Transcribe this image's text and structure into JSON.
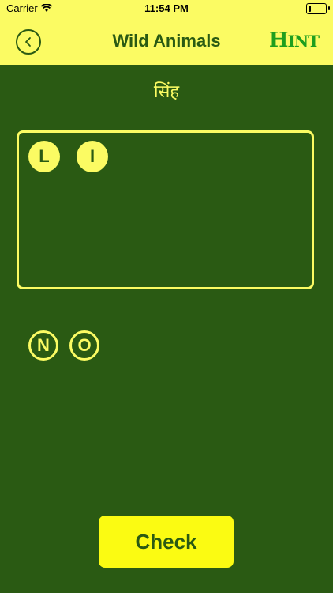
{
  "status_bar": {
    "carrier": "Carrier",
    "time": "11:54 PM"
  },
  "nav": {
    "title": "Wild Animals",
    "hint_big": "H",
    "hint_rest": "INT",
    "back_icon": "chevron-left-icon"
  },
  "clue": "सिंह",
  "answer": {
    "letters": [
      "L",
      "I"
    ]
  },
  "choices": {
    "letters": [
      "N",
      "O"
    ]
  },
  "check_label": "Check",
  "colors": {
    "background": "#2a5a13",
    "accent": "#fbfb63",
    "hint": "#1e9e1e"
  }
}
